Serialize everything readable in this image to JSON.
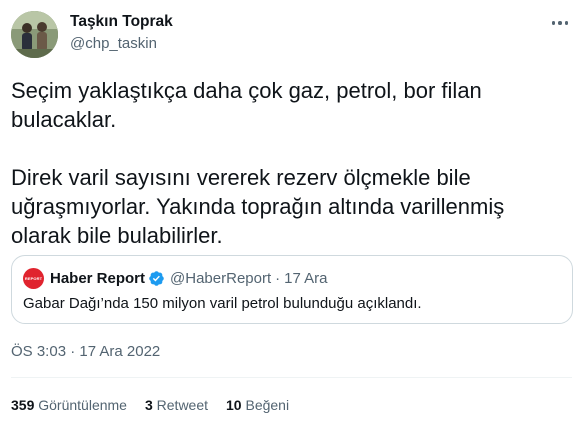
{
  "author": {
    "name": "Taşkın Toprak",
    "handle": "@chp_taskin"
  },
  "tweet": {
    "paragraph_1": "Seçim yaklaştıkça daha çok gaz, petrol, bor filan bulacaklar.",
    "paragraph_2": "Direk varil sayısını vererek rezerv ölçmekle bile uğraşmıyorlar. Yakında toprağın altında varillenmiş olarak bile bulabilirler.",
    "timestamp": "ÖS 3:03 · 17 Ara 2022"
  },
  "quote": {
    "logo_text": "REPORT",
    "name": "Haber Report",
    "handle": "@HaberReport",
    "separator": "·",
    "date": "17 Ara",
    "text": "Gabar Dağı’nda 150 milyon varil petrol bulunduğu açıklandı."
  },
  "stats": {
    "views_count": "359",
    "views_label": "Görüntülenme",
    "retweets_count": "3",
    "retweets_label": "Retweet",
    "likes_count": "10",
    "likes_label": "Beğeni"
  },
  "colors": {
    "text_primary": "#0f1419",
    "text_secondary": "#536471",
    "border": "#cfd9de",
    "verified_blue": "#1d9bf0",
    "quote_logo_red": "#e0232e"
  },
  "icons": {
    "more": "more-dots-icon",
    "verified": "verified-badge-icon"
  }
}
